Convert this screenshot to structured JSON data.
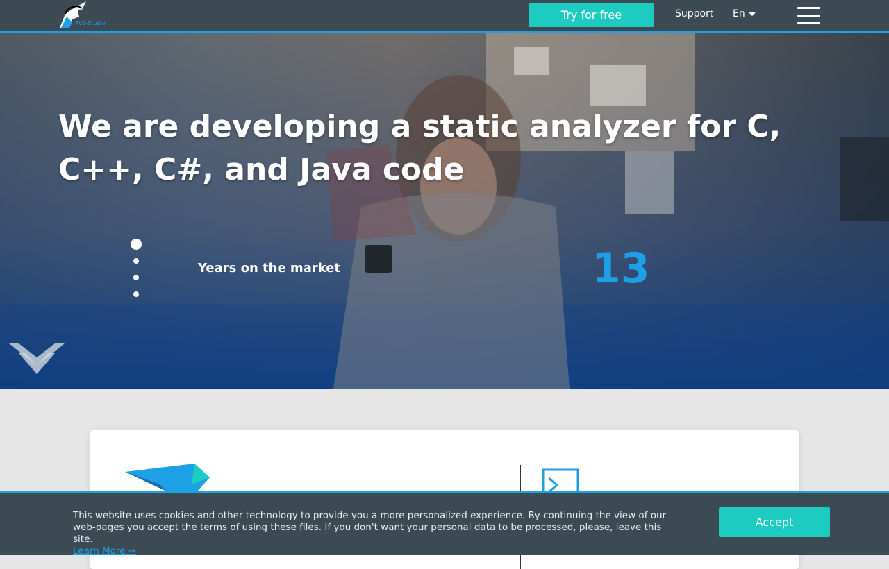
{
  "header": {
    "logo_text": "PVS-Studio",
    "try_label": "Try for free",
    "support_label": "Support",
    "lang_label": "En"
  },
  "hero": {
    "title": "We are developing a static analyzer for C, C++, C#, and Java code",
    "stat_label": "Years on the market",
    "stat_value": "13",
    "slide_count": 4,
    "active_slide": 1
  },
  "cookie": {
    "text": "This website uses cookies and other technology to provide you a more personalized experience. By continuing the view of our web-pages you accept the terms of using these files. If you don't want your personal data to be processed, please, leave this site.",
    "learn_more": "Learn More →",
    "accept_label": "Accept"
  },
  "colors": {
    "accent": "#1ea0e6",
    "button": "#1ecbc0",
    "header_bg": "#3c4a53"
  },
  "icons": [
    "unicorn-logo-icon",
    "caret-down-icon",
    "hamburger-menu-icon",
    "scroll-down-chevron-icon",
    "terminal-icon"
  ]
}
